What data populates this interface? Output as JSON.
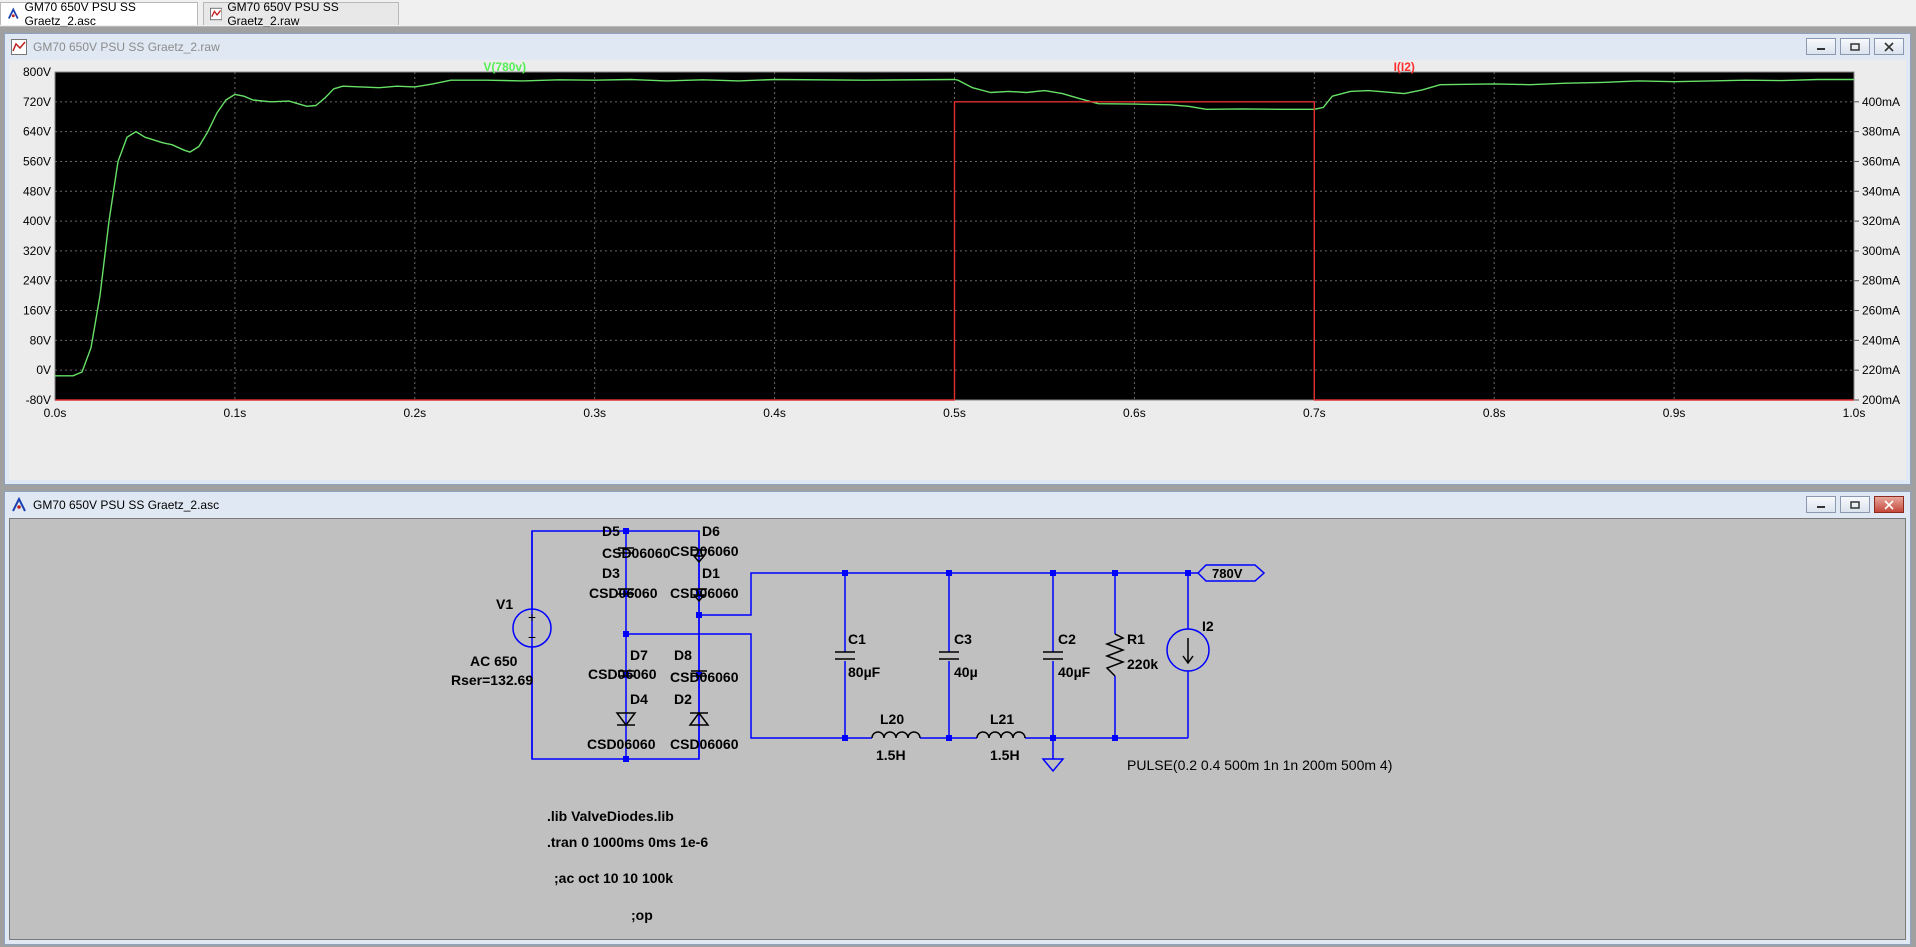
{
  "tabs": [
    {
      "label": "GM70 650V PSU SS Graetz_2.asc",
      "icon": "schematic-icon",
      "active": true
    },
    {
      "label": "GM70 650V PSU SS Graetz_2.raw",
      "icon": "waveform-icon",
      "active": false
    }
  ],
  "plot_window": {
    "title": "GM70 650V PSU SS Graetz_2.raw",
    "trace_labels": {
      "voltage": "V(780v)",
      "current": "I(I2)"
    }
  },
  "schematic_window": {
    "title": "GM70 650V PSU SS Graetz_2.asc",
    "components": {
      "V1": {
        "name": "V1",
        "value": "AC 650",
        "extra": "Rser=132.69"
      },
      "D5": {
        "name": "D5",
        "model": "CSD06060"
      },
      "D6": {
        "name": "D6",
        "model": "CSD06060"
      },
      "D3": {
        "name": "D3",
        "model": "CSD06060"
      },
      "D1": {
        "name": "D1",
        "model": "CSD06060"
      },
      "D7": {
        "name": "D7",
        "model": "CSD06060"
      },
      "D8": {
        "name": "D8",
        "model": "CSD06060"
      },
      "D4": {
        "name": "D4",
        "model": "CSD06060"
      },
      "D2": {
        "name": "D2",
        "model": "CSD06060"
      },
      "C1": {
        "name": "C1",
        "value": "80µF"
      },
      "C3": {
        "name": "C3",
        "value": "40µ"
      },
      "C2": {
        "name": "C2",
        "value": "40µF"
      },
      "R1": {
        "name": "R1",
        "value": "220k"
      },
      "I2": {
        "name": "I2",
        "value": "PULSE(0.2 0.4 500m 1n 1n 200m 500m 4)"
      },
      "L20": {
        "name": "L20",
        "value": "1.5H"
      },
      "L21": {
        "name": "L21",
        "value": "1.5H"
      }
    },
    "net_label": "780V",
    "directives": [
      ".lib ValveDiodes.lib",
      ".tran 0 1000ms 0ms 1e-6",
      ";ac oct 10 10 100k",
      ";op"
    ]
  },
  "colors": {
    "voltage_trace": "#66e066",
    "current_trace": "#e03030",
    "plot_bg": "#000000",
    "wire": "#0000ff",
    "grid": "#6a6a6a"
  },
  "chart_data": {
    "type": "line",
    "title": "",
    "xlabel": "",
    "xlim": [
      0,
      1.0
    ],
    "x_ticks": [
      "0.0s",
      "0.1s",
      "0.2s",
      "0.3s",
      "0.4s",
      "0.5s",
      "0.6s",
      "0.7s",
      "0.8s",
      "0.9s",
      "1.0s"
    ],
    "y_left": {
      "lim": [
        -80,
        800
      ],
      "ticks": [
        "800V",
        "720V",
        "640V",
        "560V",
        "480V",
        "400V",
        "320V",
        "240V",
        "160V",
        "80V",
        "0V",
        "-80V"
      ]
    },
    "y_right": {
      "lim": [
        200,
        420
      ],
      "ticks": [
        "400mA",
        "380mA",
        "360mA",
        "340mA",
        "320mA",
        "300mA",
        "280mA",
        "260mA",
        "240mA",
        "220mA",
        "200mA"
      ]
    },
    "grid": true,
    "series": [
      {
        "name": "V(780v)",
        "axis": "left",
        "unit": "V",
        "points": [
          [
            0,
            -15
          ],
          [
            0.01,
            -15
          ],
          [
            0.015,
            -5
          ],
          [
            0.02,
            60
          ],
          [
            0.025,
            200
          ],
          [
            0.03,
            400
          ],
          [
            0.035,
            560
          ],
          [
            0.04,
            625
          ],
          [
            0.045,
            640
          ],
          [
            0.05,
            625
          ],
          [
            0.06,
            610
          ],
          [
            0.065,
            605
          ],
          [
            0.072,
            590
          ],
          [
            0.075,
            585
          ],
          [
            0.08,
            600
          ],
          [
            0.085,
            640
          ],
          [
            0.09,
            690
          ],
          [
            0.095,
            725
          ],
          [
            0.1,
            740
          ],
          [
            0.105,
            735
          ],
          [
            0.11,
            725
          ],
          [
            0.12,
            720
          ],
          [
            0.13,
            722
          ],
          [
            0.135,
            715
          ],
          [
            0.14,
            708
          ],
          [
            0.145,
            710
          ],
          [
            0.15,
            730
          ],
          [
            0.155,
            755
          ],
          [
            0.16,
            762
          ],
          [
            0.17,
            760
          ],
          [
            0.18,
            758
          ],
          [
            0.19,
            762
          ],
          [
            0.2,
            760
          ],
          [
            0.21,
            768
          ],
          [
            0.22,
            778
          ],
          [
            0.24,
            778
          ],
          [
            0.26,
            776
          ],
          [
            0.28,
            779
          ],
          [
            0.3,
            778
          ],
          [
            0.32,
            780
          ],
          [
            0.34,
            776
          ],
          [
            0.36,
            779
          ],
          [
            0.38,
            776
          ],
          [
            0.4,
            780
          ],
          [
            0.45,
            778
          ],
          [
            0.5,
            780
          ],
          [
            0.502,
            778
          ],
          [
            0.51,
            758
          ],
          [
            0.52,
            745
          ],
          [
            0.53,
            748
          ],
          [
            0.54,
            745
          ],
          [
            0.55,
            750
          ],
          [
            0.56,
            742
          ],
          [
            0.57,
            728
          ],
          [
            0.58,
            715
          ],
          [
            0.6,
            714
          ],
          [
            0.62,
            712
          ],
          [
            0.63,
            708
          ],
          [
            0.64,
            700
          ],
          [
            0.66,
            701
          ],
          [
            0.68,
            700
          ],
          [
            0.7,
            700
          ],
          [
            0.705,
            705
          ],
          [
            0.71,
            735
          ],
          [
            0.72,
            748
          ],
          [
            0.73,
            750
          ],
          [
            0.74,
            746
          ],
          [
            0.75,
            742
          ],
          [
            0.76,
            752
          ],
          [
            0.77,
            766
          ],
          [
            0.8,
            768
          ],
          [
            0.82,
            766
          ],
          [
            0.84,
            770
          ],
          [
            0.86,
            772
          ],
          [
            0.88,
            776
          ],
          [
            0.9,
            774
          ],
          [
            0.92,
            776
          ],
          [
            0.94,
            778
          ],
          [
            0.96,
            777
          ],
          [
            0.98,
            780
          ],
          [
            1.0,
            780
          ]
        ]
      },
      {
        "name": "I(I2)",
        "axis": "right",
        "unit": "mA",
        "points": [
          [
            0,
            200
          ],
          [
            0.5,
            200
          ],
          [
            0.5,
            400
          ],
          [
            0.7,
            400
          ],
          [
            0.7,
            200
          ],
          [
            1.0,
            200
          ]
        ]
      }
    ]
  }
}
